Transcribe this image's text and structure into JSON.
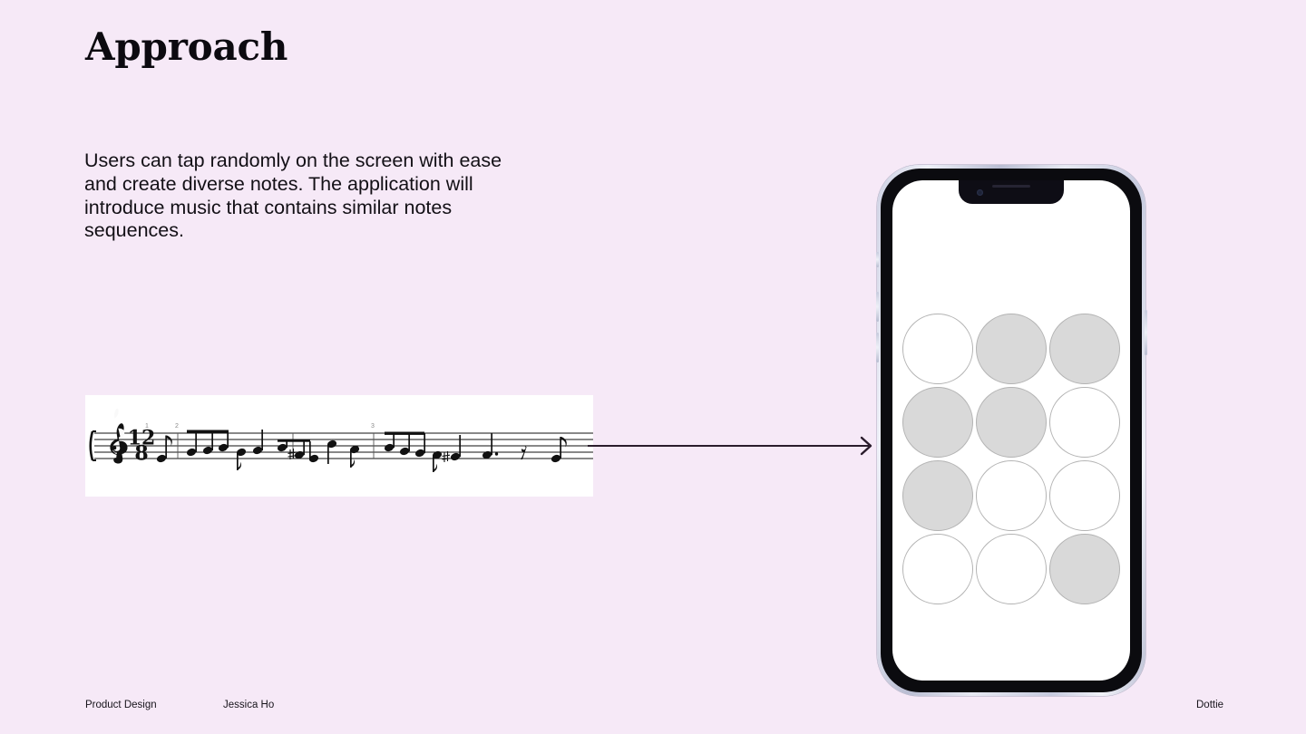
{
  "slide": {
    "background_color": "#f6e9f7",
    "title": "Approach",
    "body": "Users can tap randomly on the screen with ease and create diverse notes. The application will introduce music that contains similar notes sequences."
  },
  "sheet_music": {
    "panel_background": "#ffffff",
    "clef": "treble-clef",
    "time_signature_top": "12",
    "time_signature_bottom": "8",
    "measure_numbers": [
      "1",
      "2",
      "3"
    ],
    "staff_line_count": 5,
    "has_brace": true,
    "description": "Single-staff melodic line in 12/8 with eighth notes, beamed groups, a sharp accidental, a dotted quarter and an eighth rest."
  },
  "flow_arrow": {
    "name": "arrow-right",
    "color": "#2a1c2c",
    "direction": "left-to-right"
  },
  "phone": {
    "frame_color": "#0b0b0f",
    "screen_color": "#ffffff",
    "notch": {
      "speaker": "notch-speaker",
      "camera": "notch-camera"
    },
    "buttons": [
      "mute-switch",
      "volume-up",
      "volume-down",
      "power"
    ],
    "tap_grid": {
      "columns": 3,
      "rows": 4,
      "dot_fill_color": "#d9d9d9",
      "dot_empty_color": "#ffffff",
      "dot_border_color": "#b3b3b3",
      "dots": [
        {
          "id": "dot-r1c1",
          "filled": false
        },
        {
          "id": "dot-r1c2",
          "filled": true
        },
        {
          "id": "dot-r1c3",
          "filled": true
        },
        {
          "id": "dot-r2c1",
          "filled": true
        },
        {
          "id": "dot-r2c2",
          "filled": true
        },
        {
          "id": "dot-r2c3",
          "filled": false
        },
        {
          "id": "dot-r3c1",
          "filled": true
        },
        {
          "id": "dot-r3c2",
          "filled": false
        },
        {
          "id": "dot-r3c3",
          "filled": false
        },
        {
          "id": "dot-r4c1",
          "filled": false
        },
        {
          "id": "dot-r4c2",
          "filled": false
        },
        {
          "id": "dot-r4c3",
          "filled": true
        }
      ]
    }
  },
  "footer": {
    "category": "Product Design",
    "author": "Jessica Ho",
    "product": "Dottie"
  }
}
